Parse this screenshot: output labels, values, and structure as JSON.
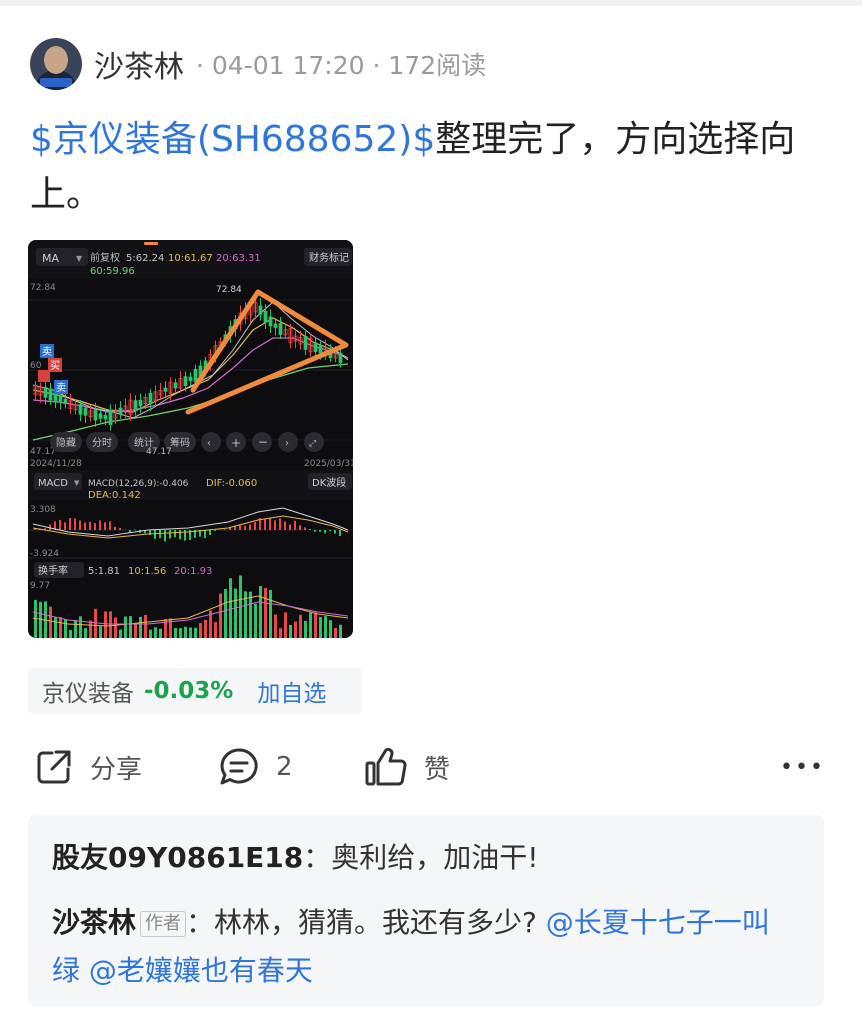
{
  "post": {
    "author": "沙茶林",
    "separator": "·",
    "time": "04-01 17:20",
    "reads": "172阅读",
    "stock_tag": "$京仪装备(SH688652)$",
    "text": "整理完了，方向选择向上。"
  },
  "chart": {
    "ma_label": "MA",
    "adjust": "前复权",
    "ma5": "5:62.24",
    "ma10": "10:61.67",
    "ma20": "20:63.31",
    "ma60": "60:59.96",
    "finance_btn": "财务标记",
    "high_label": "72.84",
    "y_top": "72.84",
    "y_mid": "60",
    "y_low": "47.17",
    "low_label": "47.17",
    "date_start": "2024/11/28",
    "date_end": "2025/03/31",
    "ctrl_1": "隐藏",
    "ctrl_2": "分时",
    "ctrl_3": "统计",
    "ctrl_4": "筹码",
    "sell1": "卖",
    "buy1": "买",
    "sell2": "卖",
    "macd_label": "MACD",
    "macd_params": "MACD(12,26,9):-0.406",
    "dif": "DIF:-0.060",
    "dea": "DEA:0.142",
    "macd_btn": "DK波段",
    "macd_top": "3.308",
    "macd_bot": "-3.924",
    "turnover_label": "换手率",
    "to5": "5:1.81",
    "to10": "10:1.56",
    "to20": "20:1.93",
    "to_top": "9.77"
  },
  "quote": {
    "name": "京仪装备",
    "change": "-0.03%",
    "add_label": "加自选"
  },
  "actions": {
    "share_label": "分享",
    "comment_count": "2",
    "like_label": "赞",
    "more_label": "•••"
  },
  "comments": [
    {
      "user": "股友09Y0861E18",
      "colon": "：",
      "text": "奥利给，加油干!"
    },
    {
      "user": "沙茶林",
      "badge": "作者",
      "colon": "：",
      "text": "林林，猜猜。我还有多少? ",
      "mentions": [
        "@长夏十七子一叫绿",
        " @老孃孃也有春天"
      ]
    }
  ],
  "colors": {
    "link_blue": "#2f76db",
    "down_green": "#1aa34a",
    "annotation_orange": "#f08a3c",
    "chart_bg": "#0d0d10"
  }
}
